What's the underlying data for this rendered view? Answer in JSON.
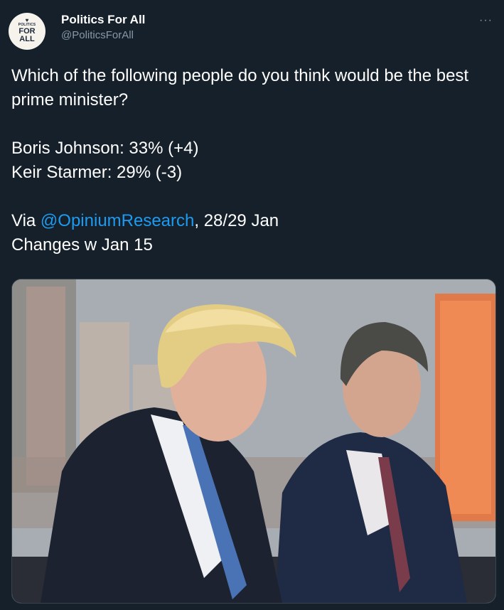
{
  "account": {
    "avatar_line1": "POLITICS",
    "avatar_line2": "FOR",
    "avatar_line3": "ALL",
    "display_name": "Politics For All",
    "handle": "@PoliticsForAll"
  },
  "more_icon": "···",
  "tweet": {
    "question": "Which of the following people do you think would be the best prime minister?",
    "result_1": "Boris Johnson: 33% (+4)",
    "result_2": "Keir Starmer: 29% (-3)",
    "source_prefix": "Via ",
    "source_mention": "@OpiniumResearch",
    "source_suffix": ", 28/29 Jan",
    "changes": "Changes w Jan 15"
  },
  "colors": {
    "background": "#15202b",
    "text": "#ffffff",
    "secondary": "#8899a6",
    "link": "#1d9bf0"
  }
}
